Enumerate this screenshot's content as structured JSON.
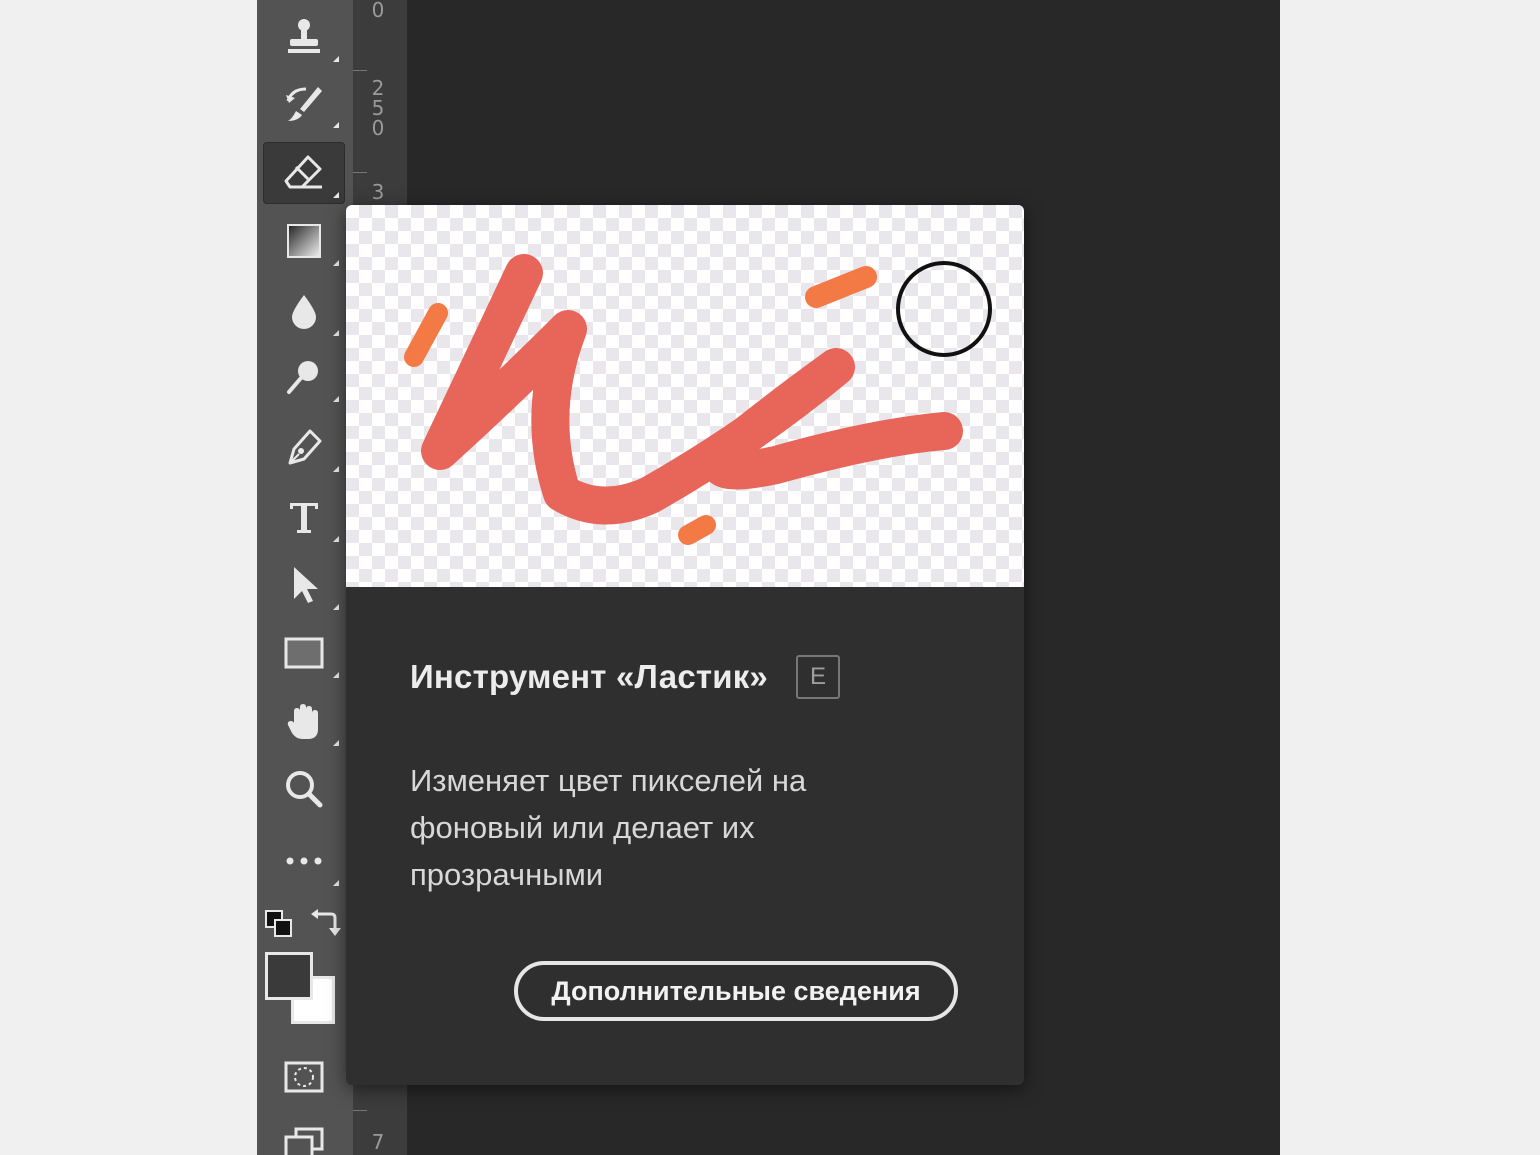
{
  "ruler": {
    "labels": [
      "0",
      "2\n5\n0",
      "3",
      "7"
    ]
  },
  "toolbar": {
    "tools": [
      {
        "name": "clone-stamp-tool",
        "icon": "stamp-icon"
      },
      {
        "name": "history-brush-tool",
        "icon": "history-brush-icon"
      },
      {
        "name": "eraser-tool",
        "icon": "eraser-icon",
        "selected": true
      },
      {
        "name": "gradient-tool",
        "icon": "gradient-icon"
      },
      {
        "name": "blur-tool",
        "icon": "drop-icon"
      },
      {
        "name": "dodge-tool",
        "icon": "dodge-icon"
      },
      {
        "name": "pen-tool",
        "icon": "pen-icon"
      },
      {
        "name": "type-tool",
        "icon": "type-icon"
      },
      {
        "name": "path-selection-tool",
        "icon": "arrow-icon"
      },
      {
        "name": "rectangle-tool",
        "icon": "rectangle-icon"
      },
      {
        "name": "hand-tool",
        "icon": "hand-icon"
      },
      {
        "name": "zoom-tool",
        "icon": "magnifier-icon"
      },
      {
        "name": "more-tools",
        "icon": "ellipsis-icon"
      }
    ],
    "foreground_color": "#3a3a3a",
    "background_color": "#ffffff"
  },
  "tooltip": {
    "title": "Инструмент «Ластик»",
    "shortcut": "E",
    "description": "Изменяет цвет пикселей на фоновый или делает их прозрачными",
    "button_label": "Дополнительные сведения",
    "stroke_color": "#e8655a",
    "accent_color": "#f47a45"
  }
}
